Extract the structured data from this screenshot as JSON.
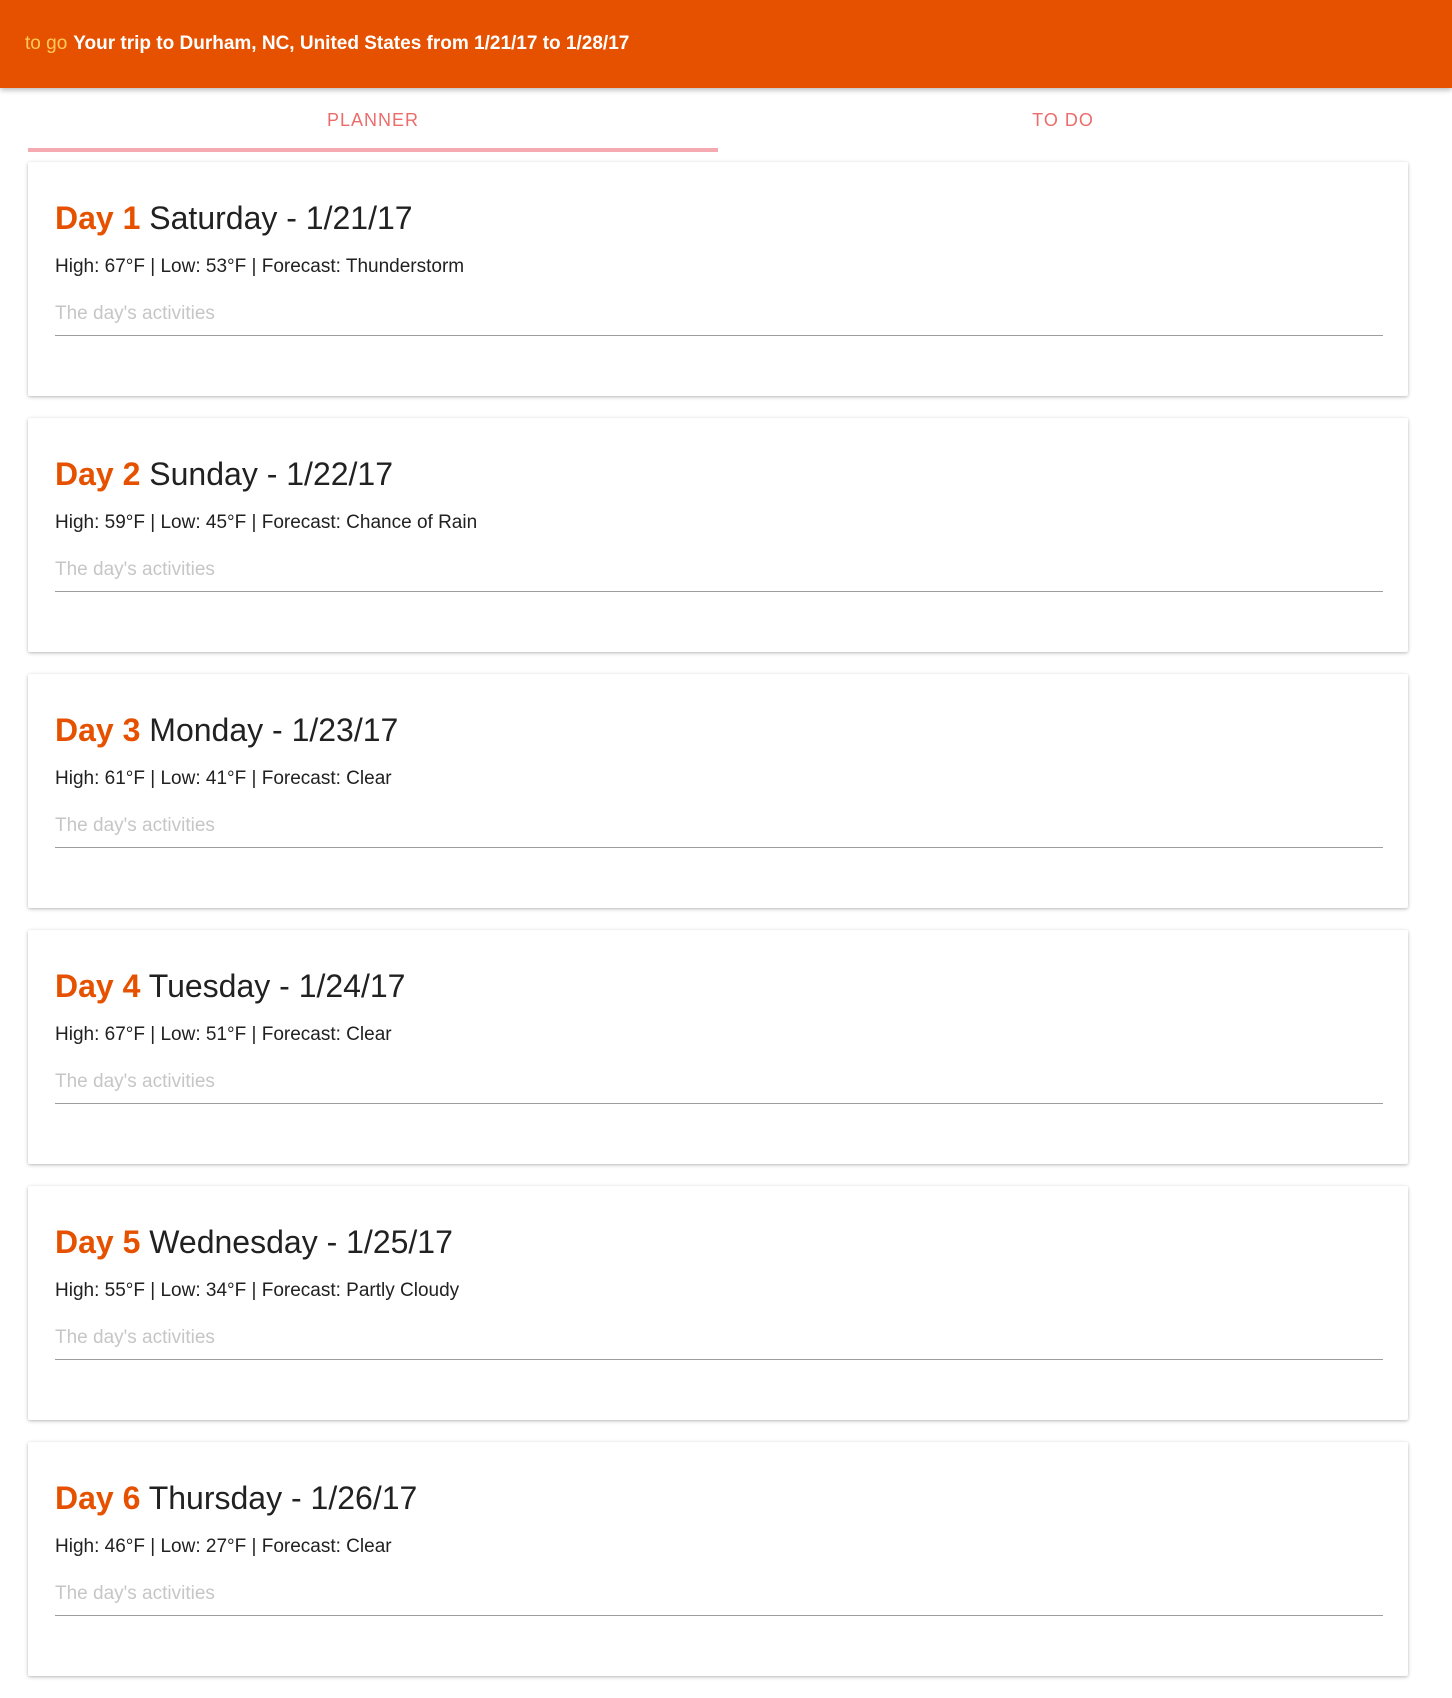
{
  "header": {
    "brand": "to go",
    "trip_title": "Your trip to Durham, NC, United States from 1/21/17 to 1/28/17"
  },
  "tabs": [
    {
      "label": "PLANNER",
      "active": true
    },
    {
      "label": "TO DO",
      "active": false
    }
  ],
  "days": [
    {
      "day_label": "Day 1",
      "date_label": "Saturday - 1/21/17",
      "weather": "High: 67°F | Low: 53°F | Forecast: Thunderstorm",
      "activities_placeholder": "The day's activities",
      "activities_value": ""
    },
    {
      "day_label": "Day 2",
      "date_label": "Sunday - 1/22/17",
      "weather": "High: 59°F | Low: 45°F | Forecast: Chance of Rain",
      "activities_placeholder": "The day's activities",
      "activities_value": ""
    },
    {
      "day_label": "Day 3",
      "date_label": "Monday - 1/23/17",
      "weather": "High: 61°F | Low: 41°F | Forecast: Clear",
      "activities_placeholder": "The day's activities",
      "activities_value": ""
    },
    {
      "day_label": "Day 4",
      "date_label": "Tuesday - 1/24/17",
      "weather": "High: 67°F | Low: 51°F | Forecast: Clear",
      "activities_placeholder": "The day's activities",
      "activities_value": ""
    },
    {
      "day_label": "Day 5",
      "date_label": "Wednesday - 1/25/17",
      "weather": "High: 55°F | Low: 34°F | Forecast: Partly Cloudy",
      "activities_placeholder": "The day's activities",
      "activities_value": ""
    },
    {
      "day_label": "Day 6",
      "date_label": "Thursday - 1/26/17",
      "weather": "High: 46°F | Low: 27°F | Forecast: Clear",
      "activities_placeholder": "The day's activities",
      "activities_value": ""
    }
  ],
  "colors": {
    "header_bg": "#e65100",
    "brand": "#ffca5c",
    "accent": "#e65100",
    "tab_text": "#ec6c6c",
    "tab_indicator": "#f5a9b0"
  }
}
